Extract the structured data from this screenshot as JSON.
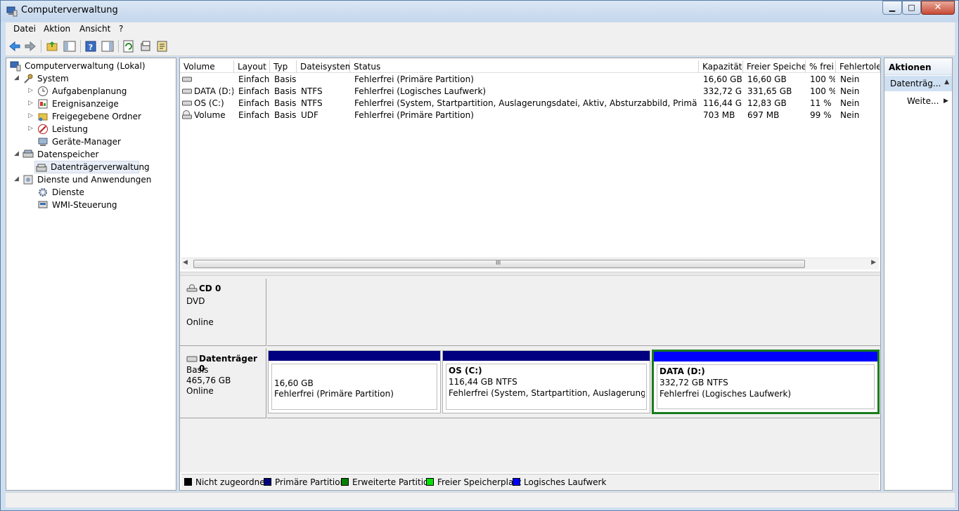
{
  "window": {
    "title": "Computerverwaltung",
    "min_label": "0",
    "max_label": "1",
    "close_label": "x"
  },
  "menu": {
    "items": [
      "Datei",
      "Aktion",
      "Ansicht",
      "?"
    ]
  },
  "toolbar": {
    "icons": [
      "back-icon",
      "forward-icon",
      "up-folder-icon",
      "show-hide-tree-icon",
      "help-icon",
      "show-hide-action-pane-icon",
      "refresh-icon",
      "properties-icon",
      "export-icon"
    ]
  },
  "tree": {
    "items": [
      {
        "label": "Computerverwaltung (Lokal)",
        "icon": "computer-management-icon",
        "arrow": ""
      },
      {
        "label": "System",
        "icon": "system-tools-icon",
        "arrow": "◢"
      },
      {
        "label": "Aufgabenplanung",
        "icon": "clock-icon",
        "arrow": "▷"
      },
      {
        "label": "Ereignisanzeige",
        "icon": "event-viewer-icon",
        "arrow": "▷"
      },
      {
        "label": "Freigegebene Ordner",
        "icon": "shared-folder-icon",
        "arrow": "▷"
      },
      {
        "label": "Leistung",
        "icon": "performance-icon",
        "arrow": "▷"
      },
      {
        "label": "Geräte-Manager",
        "icon": "device-manager-icon",
        "arrow": ""
      },
      {
        "label": "Datenspeicher",
        "icon": "storage-icon",
        "arrow": "◢"
      },
      {
        "label": "Datenträgerverwaltung",
        "icon": "disk-management-icon",
        "arrow": ""
      },
      {
        "label": "Dienste und Anwendungen",
        "icon": "services-apps-icon",
        "arrow": "◢"
      },
      {
        "label": "Dienste",
        "icon": "gear-icon",
        "arrow": ""
      },
      {
        "label": "WMI-Steuerung",
        "icon": "wmi-icon",
        "arrow": ""
      }
    ]
  },
  "volumes": {
    "columns": [
      "Volume",
      "Layout",
      "Typ",
      "Dateisystem",
      "Status",
      "Kapazität",
      "Freier Speicher",
      "% frei",
      "Fehlertoler"
    ],
    "rows": [
      {
        "volume": "",
        "layout": "Einfach",
        "typ": "Basis",
        "fs": "",
        "status": "Fehlerfrei (Primäre Partition)",
        "capacity": "16,60 GB",
        "free": "16,60 GB",
        "pct": "100 %",
        "fault": "Nein",
        "icon": "drive-icon"
      },
      {
        "volume": "DATA (D:)",
        "layout": "Einfach",
        "typ": "Basis",
        "fs": "NTFS",
        "status": "Fehlerfrei (Logisches Laufwerk)",
        "capacity": "332,72 GB",
        "free": "331,65 GB",
        "pct": "100 %",
        "fault": "Nein",
        "icon": "drive-icon"
      },
      {
        "volume": "OS (C:)",
        "layout": "Einfach",
        "typ": "Basis",
        "fs": "NTFS",
        "status": "Fehlerfrei (System, Startpartition, Auslagerungsdatei, Aktiv, Absturzabbild, Primäre Partition)",
        "capacity": "116,44 GB",
        "free": "12,83 GB",
        "pct": "11 %",
        "fault": "Nein",
        "icon": "drive-icon"
      },
      {
        "volume": "Volume",
        "layout": "Einfach",
        "typ": "Basis",
        "fs": "UDF",
        "status": "Fehlerfrei (Primäre Partition)",
        "capacity": "703 MB",
        "free": "697 MB",
        "pct": "99 %",
        "fault": "Nein",
        "icon": "cd-drive-icon"
      }
    ],
    "scroll_grip": "III"
  },
  "disks": {
    "cd": {
      "name": "CD 0",
      "type": "DVD",
      "status": "Online"
    },
    "disk0": {
      "name": "Datenträger 0",
      "type": "Basis",
      "size": "465,76 GB",
      "status": "Online",
      "partitions": [
        {
          "title": "",
          "size": "16,60 GB",
          "status": "Fehlerfrei (Primäre Partition)",
          "bar_color": "#000080"
        },
        {
          "title": "OS  (C:)",
          "size": "116,44 GB NTFS",
          "status": "Fehlerfrei (System, Startpartition, Auslagerungsdatei, A",
          "bar_color": "#000080"
        },
        {
          "title": "DATA  (D:)",
          "size": "332,72 GB NTFS",
          "status": "Fehlerfrei (Logisches Laufwerk)",
          "bar_color": "#0000ff"
        }
      ]
    }
  },
  "legend": {
    "items": [
      {
        "label": "Nicht zugeordnet",
        "color": "#000000"
      },
      {
        "label": "Primäre Partition",
        "color": "#000080"
      },
      {
        "label": "Erweiterte Partition",
        "color": "#008000"
      },
      {
        "label": "Freier Speicherplatz",
        "color": "#00e000"
      },
      {
        "label": "Logisches Laufwerk",
        "color": "#0000ff"
      }
    ]
  },
  "actions": {
    "header": "Aktionen",
    "section": "Datenträg...",
    "more": "Weite..."
  }
}
